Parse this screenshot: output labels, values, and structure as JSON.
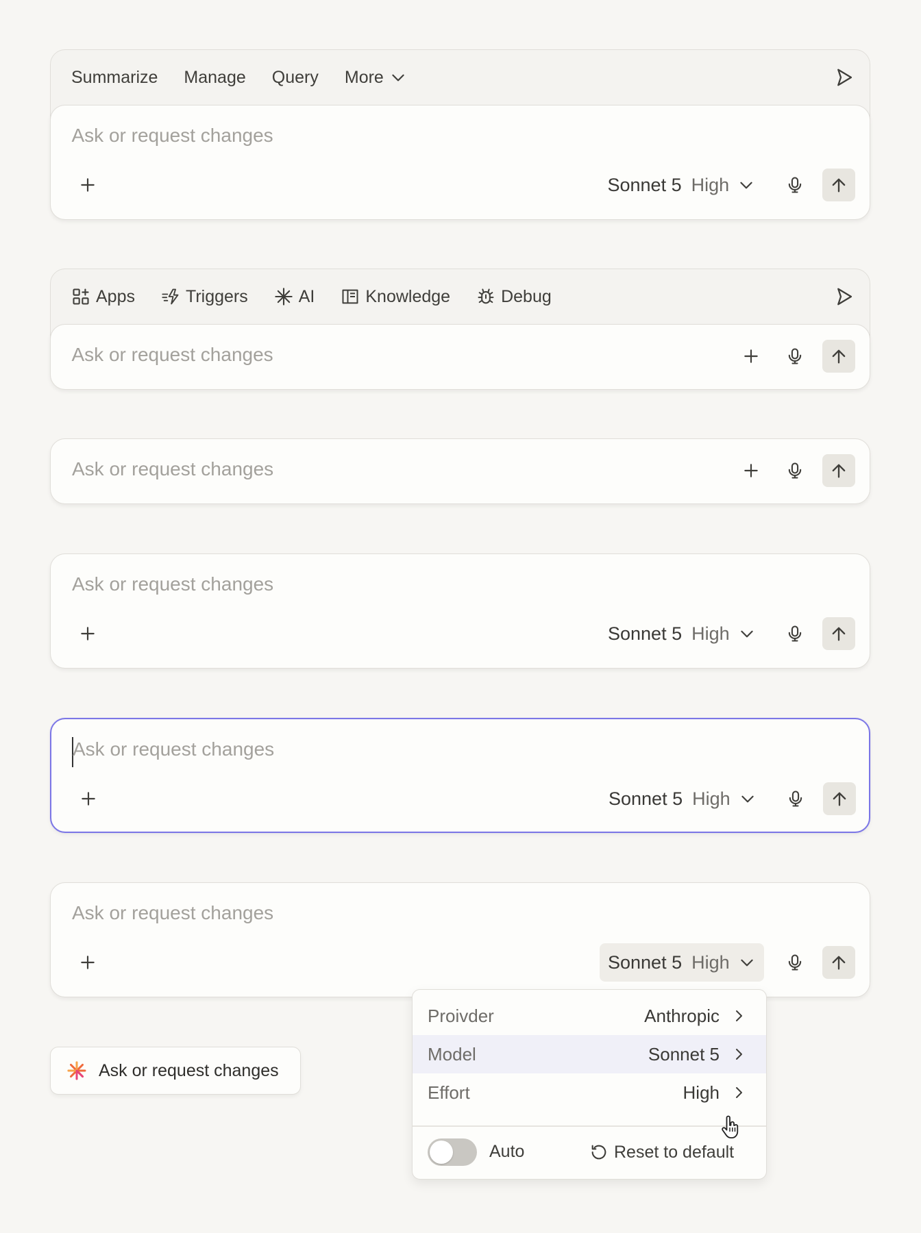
{
  "composer1": {
    "toolbar": {
      "summarize": "Summarize",
      "manage": "Manage",
      "query": "Query",
      "more": "More"
    },
    "placeholder": "Ask or request changes",
    "model": "Sonnet 5",
    "effort": "High"
  },
  "composer2": {
    "toolbar": {
      "apps": "Apps",
      "triggers": "Triggers",
      "ai": "AI",
      "knowledge": "Knowledge",
      "debug": "Debug"
    },
    "placeholder": "Ask or request changes"
  },
  "composer3": {
    "placeholder": "Ask or request changes"
  },
  "composer4": {
    "placeholder": "Ask or request changes",
    "model": "Sonnet 5",
    "effort": "High"
  },
  "composer5": {
    "placeholder": "Ask or request changes",
    "model": "Sonnet 5",
    "effort": "High"
  },
  "composer6": {
    "placeholder": "Ask or request changes",
    "model": "Sonnet 5",
    "effort": "High"
  },
  "model_menu": {
    "rows": [
      {
        "label": "Proivder",
        "value": "Anthropic"
      },
      {
        "label": "Model",
        "value": "Sonnet 5"
      },
      {
        "label": "Effort",
        "value": "High"
      }
    ],
    "auto_label": "Auto",
    "auto_enabled": false,
    "reset_label": "Reset to default"
  },
  "pill": {
    "label": "Ask or request changes"
  },
  "colors": {
    "focus_border": "#7b76e6",
    "send_bg": "#e8e6e0",
    "highlight_row": "#f0f0f8"
  }
}
